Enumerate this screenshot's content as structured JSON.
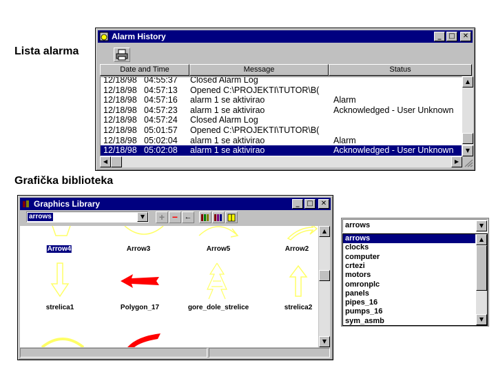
{
  "captions": {
    "alarm_list": "Lista alarma",
    "graphics_library": "Grafička biblioteka"
  },
  "alarm_window": {
    "title": "Alarm History",
    "columns": [
      "Date and Time",
      "Message",
      "Status"
    ],
    "rows": [
      {
        "date": "12/18/98",
        "time": "04:55:37",
        "message": "Closed Alarm Log",
        "status": ""
      },
      {
        "date": "12/18/98",
        "time": "04:57:13",
        "message": "Opened C:\\PROJEKTI\\TUTOR\\B(",
        "status": ""
      },
      {
        "date": "12/18/98",
        "time": "04:57:16",
        "message": "alarm 1 se aktivirao",
        "status": "Alarm"
      },
      {
        "date": "12/18/98",
        "time": "04:57:23",
        "message": "alarm 1 se aktivirao",
        "status": "Acknowledged - User Unknown"
      },
      {
        "date": "12/18/98",
        "time": "04:57:24",
        "message": "Closed Alarm Log",
        "status": ""
      },
      {
        "date": "12/18/98",
        "time": "05:01:57",
        "message": "Opened C:\\PROJEKTI\\TUTOR\\B(",
        "status": ""
      },
      {
        "date": "12/18/98",
        "time": "05:02:04",
        "message": "alarm 1 se aktivirao",
        "status": "Alarm"
      },
      {
        "date": "12/18/98",
        "time": "05:02:08",
        "message": "alarm 1 se aktivirao",
        "status": "Acknowledged - User Unknown"
      }
    ],
    "selected_row": 7
  },
  "graphics_window": {
    "title": "Graphics Library",
    "category_value": "arrows",
    "items": [
      {
        "label": "Arrow4",
        "selected": true
      },
      {
        "label": "Arrow3",
        "selected": false
      },
      {
        "label": "Arrow5",
        "selected": false
      },
      {
        "label": "Arrow2",
        "selected": false
      },
      {
        "label": "strelica1",
        "selected": false
      },
      {
        "label": "Polygon_17",
        "selected": false
      },
      {
        "label": "gore_dole_strelice",
        "selected": false
      },
      {
        "label": "strelica2",
        "selected": false
      }
    ],
    "colors": {
      "yellow_arrow": "#ffff66",
      "red_arrow": "#ff0000"
    }
  },
  "dropdown": {
    "value": "arrows",
    "options": [
      "arrows",
      "clocks",
      "computer",
      "crtezi",
      "motors",
      "omronplc",
      "panels",
      "pipes_16",
      "pumps_16",
      "sym_asmb"
    ],
    "selected_index": 0
  },
  "colors": {
    "title_bar": "#000080",
    "window_face": "#c0c0c0",
    "selection": "#000080"
  }
}
